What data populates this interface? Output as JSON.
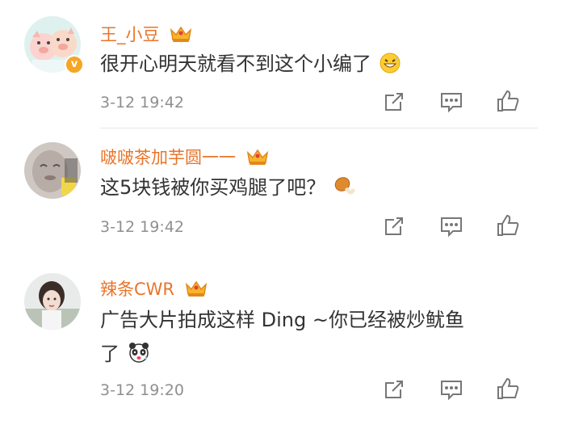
{
  "comments": [
    {
      "username": "王_小豆",
      "text": "很开心明天就看不到这个小编了",
      "time": "3-12 19:42",
      "verified": true,
      "emoji": "grinning-sweat-emoji"
    },
    {
      "username": "啵啵茶加芋圆一一",
      "text": "这5块钱被你买鸡腿了吧？",
      "time": "3-12 19:42",
      "verified": false,
      "emoji": "chicken-leg-emoji"
    },
    {
      "username": "辣条CWR",
      "text_line1": "广告大片拍成这样 Ding ~你已经被炒鱿鱼",
      "text_line2": "了",
      "time": "3-12 19:20",
      "verified": false,
      "emoji": "panda-emoji"
    }
  ],
  "icons": {
    "share": "share-icon",
    "comment": "comment-icon",
    "like": "like-icon",
    "vip_crown": "vip-crown-icon"
  },
  "colors": {
    "username": "#e8752a",
    "text": "#333333",
    "meta": "#8f8f8f",
    "divider": "#e6e6e6"
  }
}
